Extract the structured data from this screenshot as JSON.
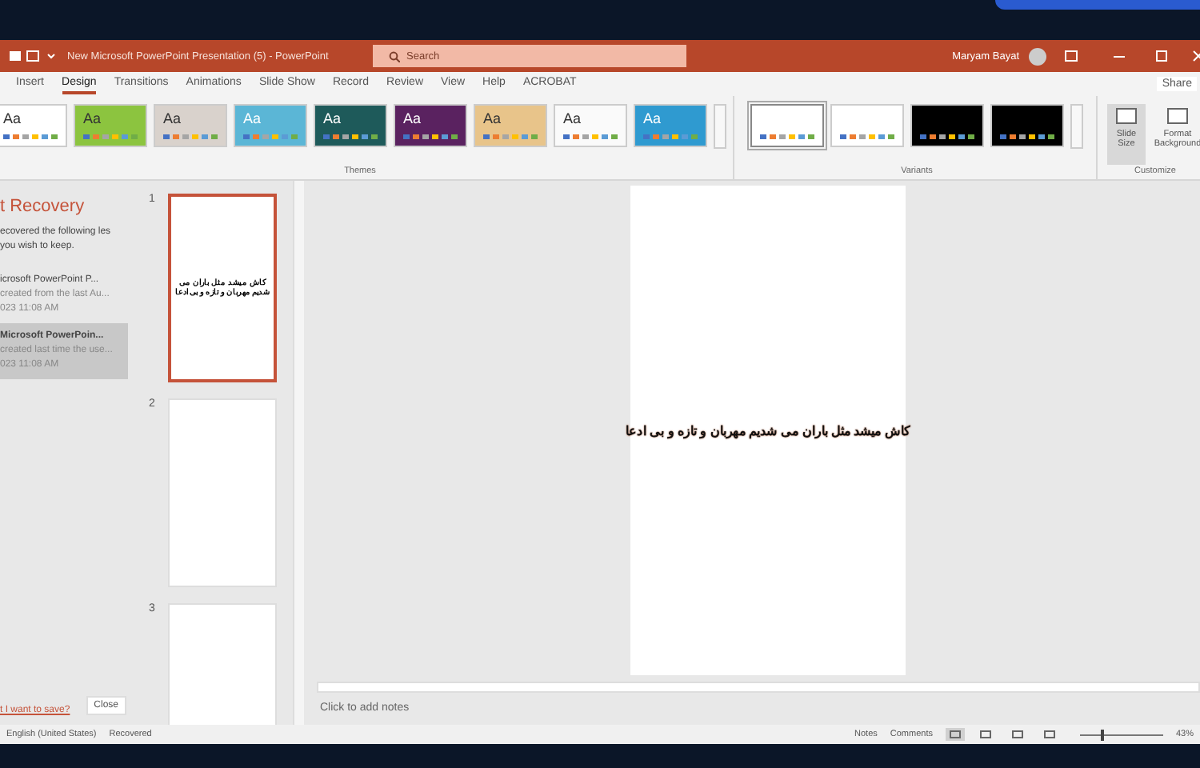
{
  "title_bar": {
    "title": "New Microsoft PowerPoint Presentation (5)  -  PowerPoint",
    "search": {
      "placeholder": "Search"
    },
    "user": "Maryam Bayat"
  },
  "ribbon_tabs": [
    {
      "label": "Insert",
      "selected": false
    },
    {
      "label": "Design",
      "selected": true
    },
    {
      "label": "Transitions",
      "selected": false
    },
    {
      "label": "Animations",
      "selected": false
    },
    {
      "label": "Slide Show",
      "selected": false
    },
    {
      "label": "Record",
      "selected": false
    },
    {
      "label": "Review",
      "selected": false
    },
    {
      "label": "View",
      "selected": false
    },
    {
      "label": "Help",
      "selected": false
    },
    {
      "label": "ACROBAT",
      "selected": false
    }
  ],
  "share": "Share",
  "themes": {
    "label": "Themes",
    "items": [
      {
        "text": "Aa",
        "color": "#ffffff"
      },
      {
        "text": "Aa",
        "color": "#8cc43f"
      },
      {
        "text": "Aa",
        "color": "#d9d2cc"
      },
      {
        "text": "Aa",
        "color": "#5bb6d6"
      },
      {
        "text": "Aa",
        "color": "#1e5a5a"
      },
      {
        "text": "Aa",
        "color": "#5a2260"
      },
      {
        "text": "Aa",
        "color": "#e8c48a"
      },
      {
        "text": "Aa",
        "color": "#fafafa"
      },
      {
        "text": "Aa",
        "color": "#2f9ad0"
      }
    ]
  },
  "variants": {
    "label": "Variants",
    "items": [
      {
        "color": "#ffffff",
        "selected": true
      },
      {
        "color": "#ffffff",
        "selected": false
      },
      {
        "color": "#000000",
        "selected": false
      },
      {
        "color": "#000000",
        "selected": false
      }
    ]
  },
  "customize": {
    "label": "Customize",
    "buttons": [
      "Slide Size",
      "Format Background"
    ]
  },
  "recovery": {
    "title": "t Recovery",
    "message": "ecovered the following les you wish to keep.",
    "files": [
      {
        "name": "icrosoft PowerPoint P...",
        "detail": "created from the last Au...",
        "time": "023 11:08 AM",
        "selected": false
      },
      {
        "name": "Microsoft PowerPoin...",
        "detail": "created last time the use...",
        "time": "023 11:08 AM",
        "selected": true
      }
    ],
    "link": "t I want to save?",
    "close": "Close"
  },
  "slides": [
    {
      "number": "1",
      "text": "کاش میشد مثل باران می شدیم مهربان و تازه و بی ادعا",
      "selected": true
    },
    {
      "number": "2",
      "selected": false
    },
    {
      "number": "3",
      "selected": false
    }
  ],
  "slide": {
    "text": "کاش میشد مثل باران می شدیم مهربان و تازه و بی ادعا"
  },
  "notes": {
    "placeholder": "Click to add notes"
  },
  "status_bar": {
    "language": "English (United States)",
    "state": "Recovered",
    "notes": "Notes",
    "comments": "Comments",
    "zoom": {
      "level": 0.25,
      "reading": "43%"
    }
  }
}
